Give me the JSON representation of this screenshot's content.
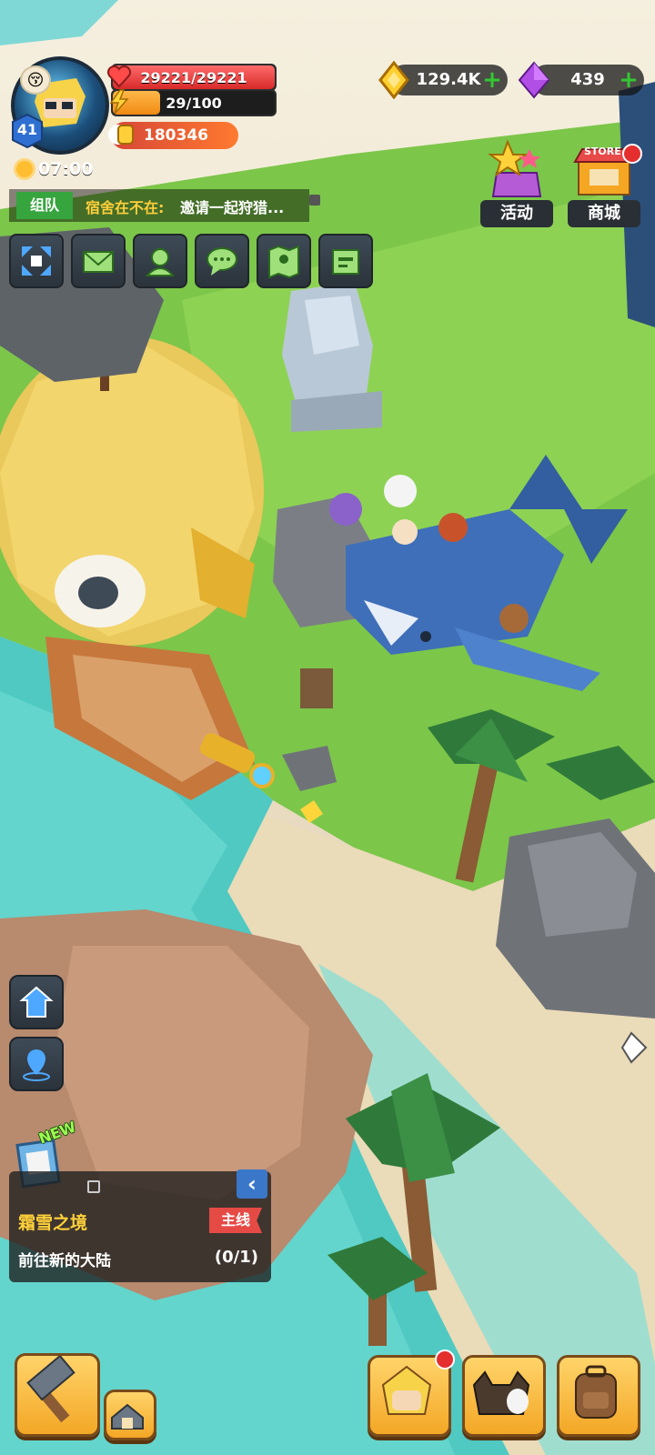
{
  "player": {
    "level": "41",
    "hp": "29221/29221",
    "energy": "29/100",
    "energy_fraction": 0.29,
    "power": "180346",
    "time": "07:00"
  },
  "currency": {
    "gold": "129.4K",
    "gems": "439"
  },
  "shop": {
    "events_label": "活动",
    "store_label": "商城",
    "store_sign": "STORE"
  },
  "chat": {
    "tag": "组队",
    "sender": "宿舍在不在:",
    "message": "邀请一起狩猎..."
  },
  "quick_icons": [
    "expand-icon",
    "mail-icon",
    "friends-icon",
    "chat-icon",
    "map-icon",
    "id-card-icon"
  ],
  "side_icons": [
    "home-icon",
    "location-pin-icon"
  ],
  "quest": {
    "new_label": "NEW",
    "title": "霜雪之境",
    "tag": "主线",
    "description": "前往新的大陆",
    "progress": "(0/1)"
  },
  "bottom_icons": [
    "forge-hammer-icon",
    "base-icon",
    "hero-icon",
    "pets-icon",
    "backpack-icon"
  ],
  "colors": {
    "hp": "#d72929",
    "energy": "#f08a12",
    "quest_title": "#ffd13a",
    "chat_name": "#ffcf3a",
    "team_tag": "#36a53e"
  }
}
